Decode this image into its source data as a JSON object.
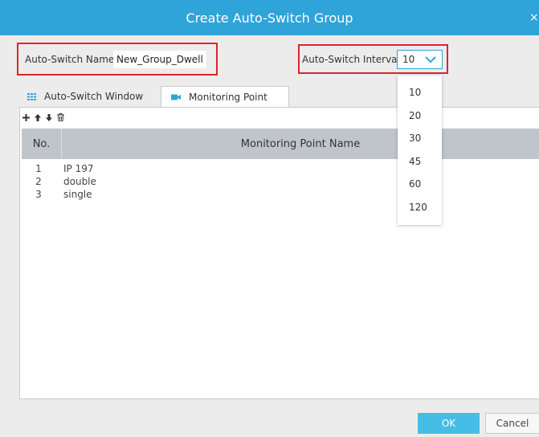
{
  "dialog": {
    "title": "Create Auto-Switch Group",
    "close_glyph": "×"
  },
  "form": {
    "name_label": "Auto-Switch Name",
    "name_value": "New_Group_Dwell",
    "interval_label": "Auto-Switch Interval",
    "interval_value": "10"
  },
  "tabs": [
    {
      "label": "Auto-Switch Window",
      "icon": "grid-icon",
      "active": false
    },
    {
      "label": "Monitoring Point",
      "icon": "camera-icon",
      "active": true
    }
  ],
  "toolbar": [
    "add-icon",
    "move-up-icon",
    "move-down-icon",
    "delete-icon"
  ],
  "table": {
    "columns": [
      "No.",
      "Monitoring Point Name"
    ],
    "rows": [
      {
        "no": "1",
        "name": "IP 197"
      },
      {
        "no": "2",
        "name": "double"
      },
      {
        "no": "3",
        "name": "single"
      }
    ]
  },
  "interval_options": [
    "10",
    "20",
    "30",
    "45",
    "60",
    "120"
  ],
  "buttons": {
    "ok": "OK",
    "cancel": "Cancel"
  },
  "colors": {
    "accent": "#2fa4d9",
    "highlight": "#e0242a",
    "ok_button": "#46bde6",
    "table_header": "#bfc5cb"
  }
}
